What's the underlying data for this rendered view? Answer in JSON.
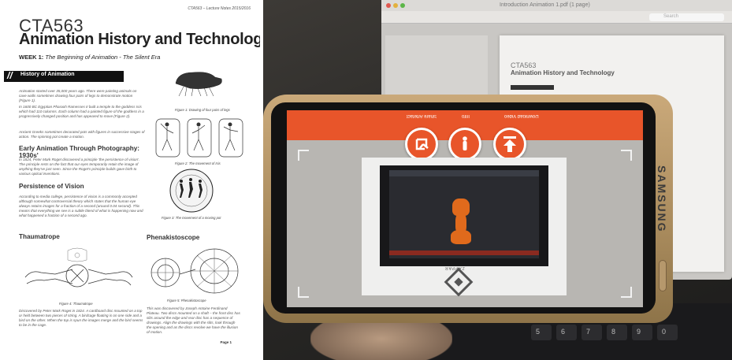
{
  "document": {
    "header": "CTA563 – Lecture Notes 2015/2016",
    "course_code": "CTA563",
    "course_title": "Animation History and Technology",
    "week_label": "WEEK 1:",
    "week_title": "The Beginning of Animation - The Silent Era",
    "section_title": "History of Animation",
    "paragraphs": {
      "p1": "Animation started over 35,000 years ago. There were painting animals on cave walls sometimes drawing four pairs of legs to demonstrate motion (Figure 1).",
      "p2": "In 1600 BC Egyptian Pharaoh Ramesses II built a temple to the goddess Isis which had 110 columns. Each column had a painted figure of the goddess in a progressively changed position and has appeared to move (Figure 2).",
      "p3": "Ancient Greeks sometimes decorated pots with figures in successive stages of action. The spinning pot create a motion.",
      "p4": "In 1824, Peter Mark Roget discovered a principle 'the persistence of vision'. The principle rests on the fact that our eyes temporarily retain the image of anything they've just seen. Since the Roget's principle builds gave birth to various optical inventions.",
      "p5": "According to media college, persistence of vision is a commonly accepted although somewhat controversial theory which states that the human eye always retains images for a fraction of a second (around 0.04 second). This means that everything we see is a subtle blend of what is happening now and what happened a fraction of a second ago.",
      "p6": "Discovered by Peter Mark Roget in 1824. A cardboard disc mounted on a top or held between two pieces of string. A birdcage floating is on one side and a bird on the other. When the top is spun the images merge and the bird seems to be in the cage.",
      "p7": "This was discovered by Joseph Antoine Ferdinand Plateau. Two discs mounted on a shaft – the front disc has slits around the edge and rear disc has a sequence of drawings. Align the drawings with the slits, look through the opening and as the discs revolve we have the illusion of motion."
    },
    "subheads": {
      "early": "Early Animation Through Photography: 1930s'",
      "persistence": "Persistence of Vision",
      "thaumatrope": "Thaumatrope",
      "phenakistoscope": "Phenakistoscope"
    },
    "captions": {
      "fig1": "Figure 1: Drawing of four pairs of legs",
      "fig2": "Figure 2: The movement of Isis",
      "fig3": "Figure 3: The movement of a moving pot",
      "fig4": "Figure 4: Thaumatrope",
      "fig5": "Figure 5: Phenakistoscope"
    },
    "page_label": "Page 1"
  },
  "photo": {
    "monitor": {
      "title": "Introduction Animation 1.pdf (1 page)",
      "search_placeholder": "Search",
      "doc_code": "CTA563",
      "doc_title": "Animation History and Technology"
    },
    "phone": {
      "brand": "SAMSUNG",
      "buttons": [
        {
          "label": "Share Artefact",
          "icon": "share-icon"
        },
        {
          "label": "Info",
          "icon": "info-icon"
        },
        {
          "label": "Download Video",
          "icon": "download-icon"
        }
      ],
      "marker_text": "ZAPPAR",
      "keyboard_keys": [
        "5",
        "6",
        "7",
        "8",
        "9",
        "0"
      ]
    }
  },
  "colors": {
    "accent_orange": "#e8552a",
    "doc_black_bar": "#111111",
    "figure_orange": "#e06a1c"
  }
}
